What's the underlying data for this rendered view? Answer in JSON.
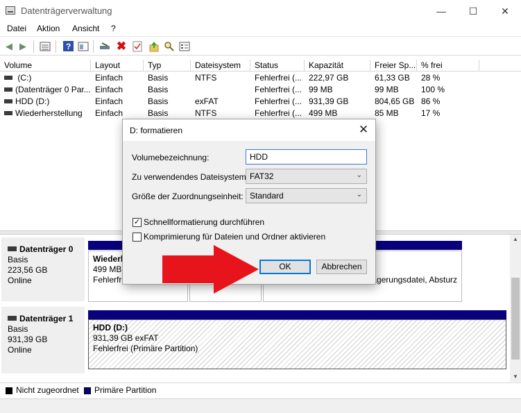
{
  "window": {
    "title": "Datenträgerverwaltung",
    "controls": {
      "minimize": "—",
      "maximize": "☐",
      "close": "✕"
    }
  },
  "menu": [
    "Datei",
    "Aktion",
    "Ansicht",
    "?"
  ],
  "toolbar": {
    "icons": [
      "back-arrow-icon",
      "forward-arrow-icon",
      "properties-list-icon",
      "help-icon",
      "panel-view-icon",
      "connect-drive-icon",
      "delete-icon",
      "check-icon",
      "up-folder-icon",
      "search-disk-icon",
      "settings-list-icon"
    ]
  },
  "volume_list": {
    "columns": [
      "Volume",
      "Layout",
      "Typ",
      "Dateisystem",
      "Status",
      "Kapazität",
      "Freier Sp...",
      "% frei"
    ],
    "rows": [
      {
        "volume": " (C:)",
        "layout": "Einfach",
        "typ": "Basis",
        "fs": "NTFS",
        "status": "Fehlerfrei (...",
        "capacity": "222,97 GB",
        "free": "61,33 GB",
        "pct": "28 %"
      },
      {
        "volume": "(Datenträger 0 Par...",
        "layout": "Einfach",
        "typ": "Basis",
        "fs": "",
        "status": "Fehlerfrei (...",
        "capacity": "99 MB",
        "free": "99 MB",
        "pct": "100 %"
      },
      {
        "volume": "HDD (D:)",
        "layout": "Einfach",
        "typ": "Basis",
        "fs": "exFAT",
        "status": "Fehlerfrei (...",
        "capacity": "931,39 GB",
        "free": "804,65 GB",
        "pct": "86 %"
      },
      {
        "volume": "Wiederherstellung",
        "layout": "Einfach",
        "typ": "Basis",
        "fs": "NTFS",
        "status": "Fehlerfrei (...",
        "capacity": "499 MB",
        "free": "85 MB",
        "pct": "17 %"
      }
    ]
  },
  "disks": [
    {
      "name": "Datenträger 0",
      "type": "Basis",
      "size": "223,56 GB",
      "state": "Online",
      "partitions": [
        {
          "line1": "Wiederh",
          "line2": "499 MB N",
          "line3": "Fehlerfrei"
        },
        {
          "line1": "",
          "line2": "",
          "line3": ""
        },
        {
          "line1": "",
          "line2": "",
          "line3": "agerungsdatei, Absturz"
        }
      ]
    },
    {
      "name": "Datenträger 1",
      "type": "Basis",
      "size": "931,39 GB",
      "state": "Online",
      "partitions": [
        {
          "line1": "HDD  (D:)",
          "line2": "931,39 GB  exFAT",
          "line3": "Fehlerfrei (Primäre Partition)"
        }
      ]
    }
  ],
  "legend": [
    {
      "label": "Nicht zugeordnet",
      "color": "#000000"
    },
    {
      "label": "Primäre Partition",
      "color": "#08007c"
    }
  ],
  "dialog": {
    "title": "D: formatieren",
    "volume_label_caption": "Volumebezeichnung:",
    "volume_label_value": "HDD",
    "fs_caption": "Zu verwendendes Dateisystem:",
    "fs_value": "FAT32",
    "alloc_caption": "Größe der Zuordnungseinheit:",
    "alloc_value": "Standard",
    "quick_format_label": "Schnellformatierung durchführen",
    "quick_format_checked": true,
    "compression_label": "Komprimierung für Dateien und Ordner aktivieren",
    "compression_checked": false,
    "ok_label": "OK",
    "cancel_label": "Abbrechen"
  },
  "colors": {
    "arrow": "#e8141b",
    "partition_bar": "#08007c",
    "accent": "#0078d7"
  }
}
